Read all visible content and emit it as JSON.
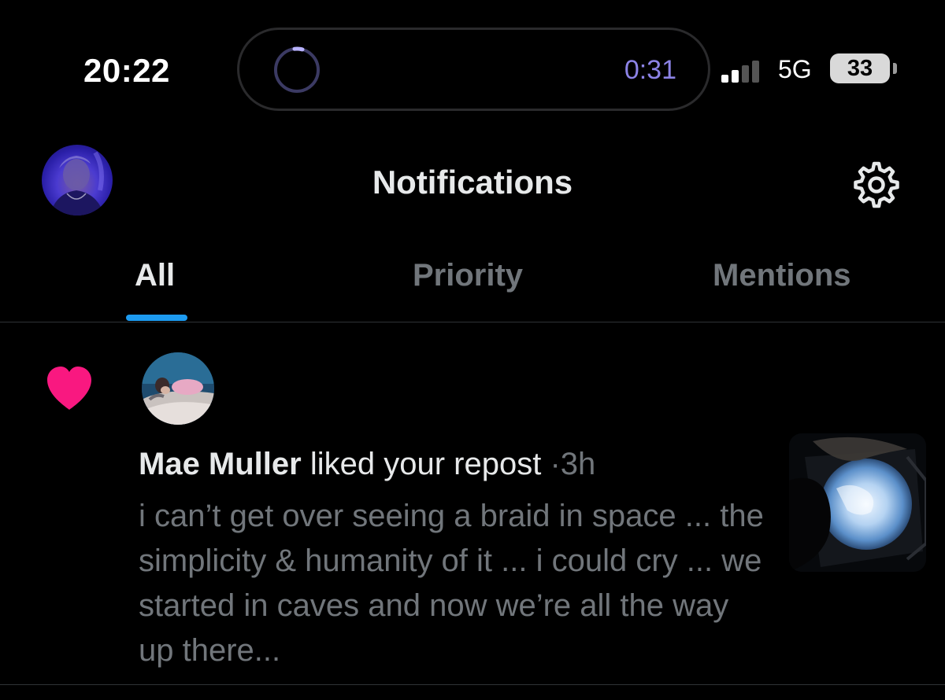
{
  "status_bar": {
    "time": "20:22",
    "activity_timer": "0:31",
    "network": "5G",
    "battery_level": "33",
    "signal_bars_filled": 2,
    "signal_bars_total": 4,
    "accent_color": "#8c83e6"
  },
  "header": {
    "title": "Notifications",
    "profile_icon": "avatar",
    "settings_icon": "gear-icon"
  },
  "tabs": [
    {
      "label": "All",
      "active": true
    },
    {
      "label": "Priority",
      "active": false
    },
    {
      "label": "Mentions",
      "active": false
    }
  ],
  "notifications": [
    {
      "type": "like",
      "icon": "heart-icon",
      "icon_color": "#f91880",
      "actor": "Mae Muller",
      "action": "liked your repost",
      "separator": "·",
      "time": "3h",
      "text": "i can’t get over seeing a braid in space ... the simplicity & humanity of it ... i could cry ... we started in caves and now we’re all the way up there..."
    }
  ],
  "colors": {
    "background": "#000000",
    "primary_text": "#e7e9ea",
    "secondary_text": "#71767b",
    "tab_indicator": "#1d9bf0",
    "divider": "#2f3336"
  }
}
